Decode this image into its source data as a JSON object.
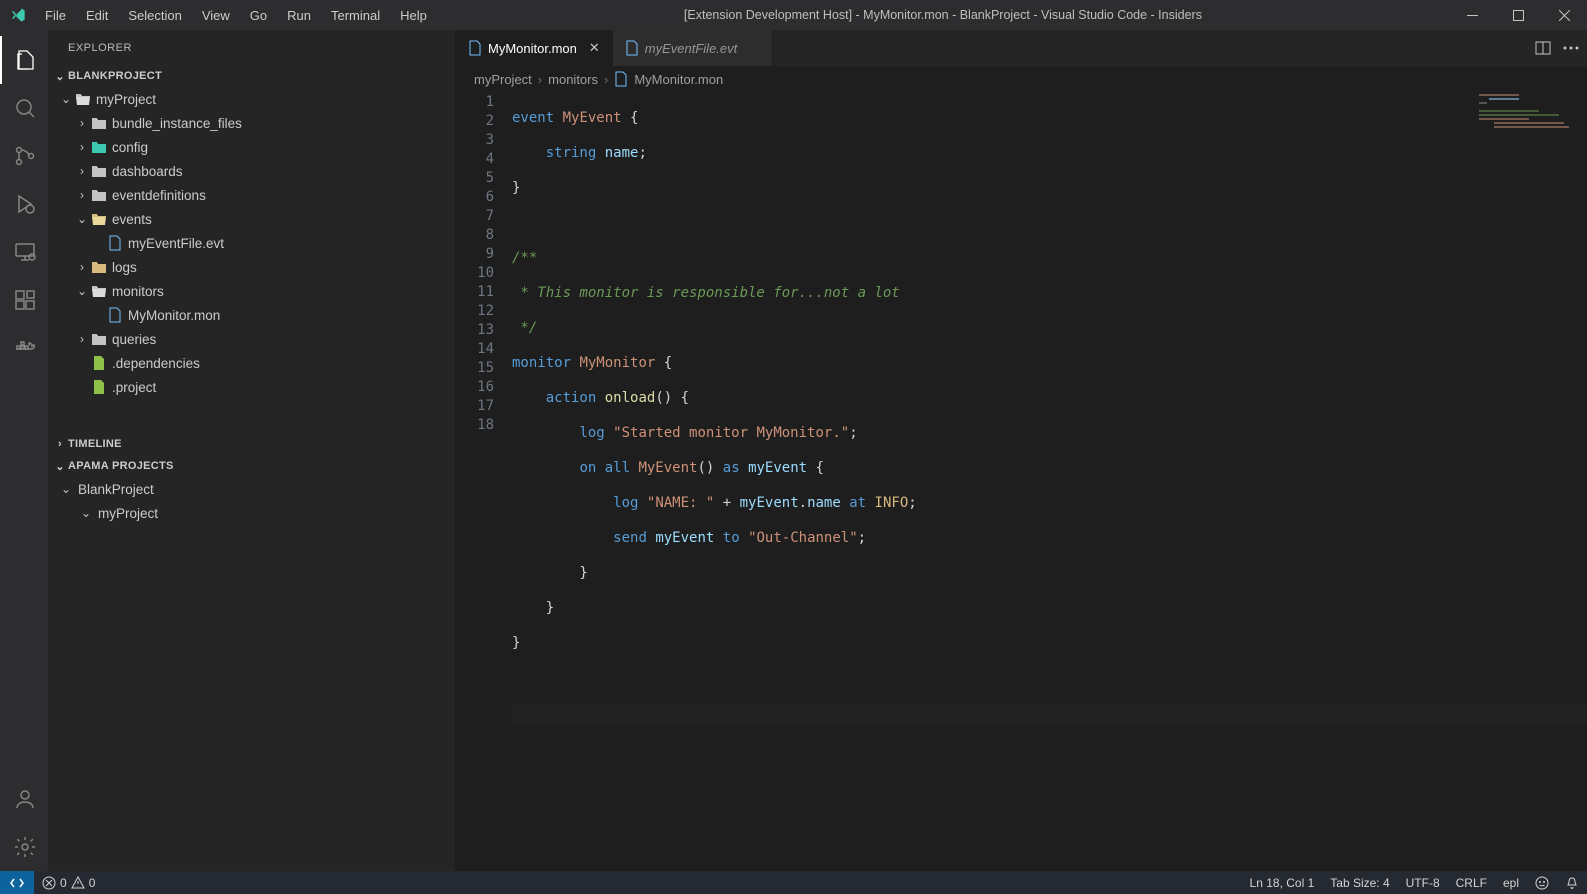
{
  "title": "[Extension Development Host] - MyMonitor.mon - BlankProject - Visual Studio Code - Insiders",
  "menus": [
    "File",
    "Edit",
    "Selection",
    "View",
    "Go",
    "Run",
    "Terminal",
    "Help"
  ],
  "sidebar": {
    "title": "EXPLORER",
    "section": "BLANKPROJECT",
    "timeline": "TIMELINE",
    "apama": "APAMA PROJECTS",
    "tree": {
      "myProject": "myProject",
      "bundle": "bundle_instance_files",
      "config": "config",
      "dashboards": "dashboards",
      "eventdefs": "eventdefinitions",
      "events": "events",
      "myEventFile": "myEventFile.evt",
      "logs": "logs",
      "monitors": "monitors",
      "myMonitor": "MyMonitor.mon",
      "queries": "queries",
      "deps": ".dependencies",
      "project": ".project"
    },
    "apama_tree": {
      "blank": "BlankProject",
      "myProject": "myProject"
    }
  },
  "tabs": [
    {
      "label": "MyMonitor.mon",
      "active": true
    },
    {
      "label": "myEventFile.evt",
      "active": false
    }
  ],
  "breadcrumb": [
    "myProject",
    "monitors",
    "MyMonitor.mon"
  ],
  "code_lines": 18,
  "status": {
    "errors": "0",
    "warnings": "0",
    "line_col": "Ln 18, Col 1",
    "tabsize": "Tab Size: 4",
    "encoding": "UTF-8",
    "eol": "CRLF",
    "lang": "epl"
  }
}
